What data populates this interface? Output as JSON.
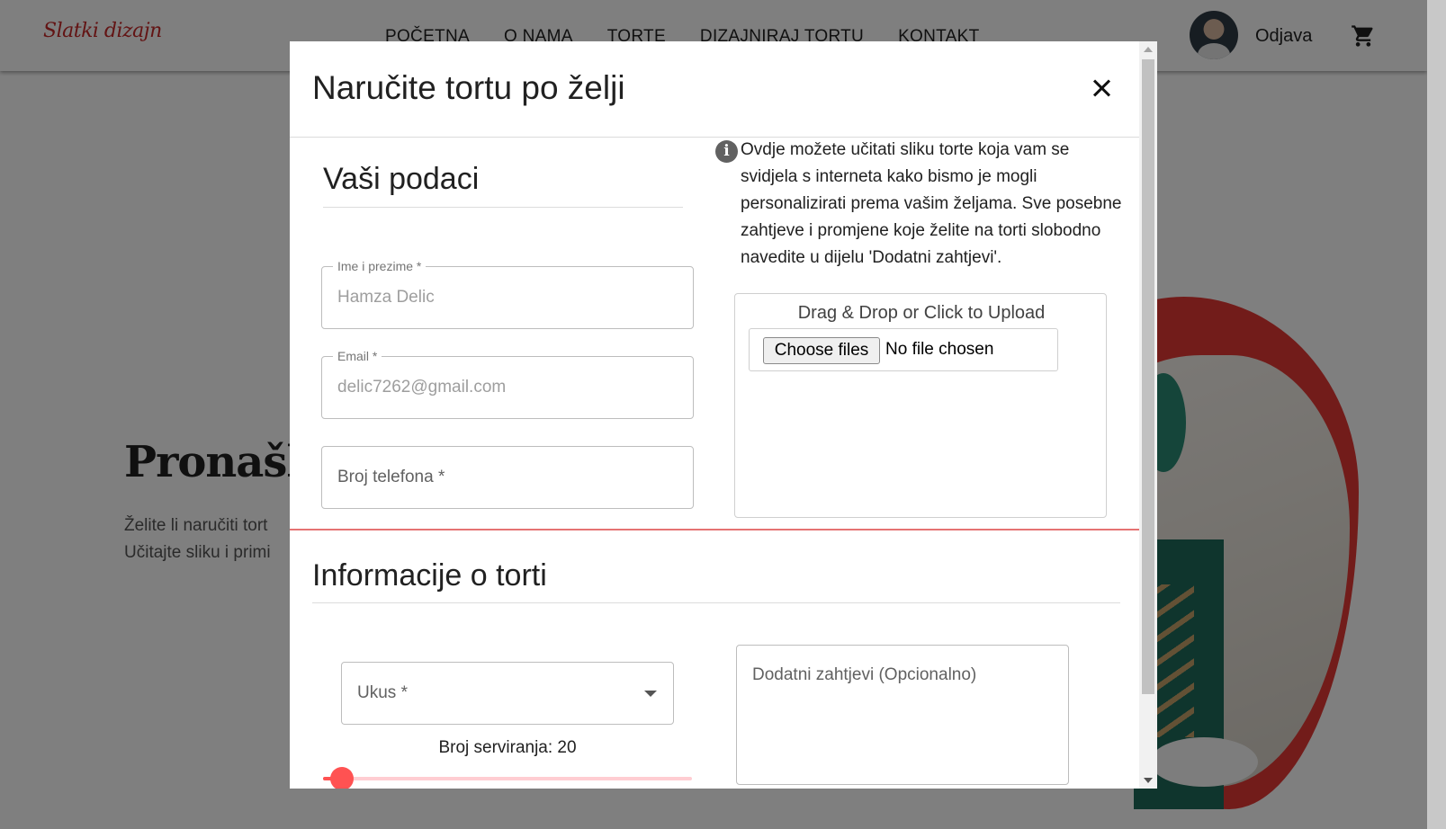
{
  "brand": {
    "logo": "Slatki dizajn",
    "accent_color": "#e53935"
  },
  "nav": {
    "links": [
      "POČETNA",
      "O NAMA",
      "TORTE",
      "DIZAJNIRAJ TORTU",
      "KONTAKT"
    ],
    "logout_label": "Odjava",
    "cart_icon": "shopping-cart-icon",
    "avatar_icon": "user-avatar"
  },
  "hero": {
    "title": "Pronašli",
    "text_line1": "Želite li naručiti tort",
    "text_line2": "Učitajte sliku i primi"
  },
  "modal": {
    "title": "Naručite tortu po želji",
    "close_icon": "close-icon",
    "personal_section": {
      "title": "Vaši podaci",
      "name_label": "Ime i prezime *",
      "name_value": "Hamza Delic",
      "email_label": "Email *",
      "email_value": "delic7262@gmail.com",
      "phone_placeholder": "Broj telefona *"
    },
    "upload": {
      "info_icon": "info-icon",
      "info_text": "Ovdje možete učitati sliku torte koja vam se svidjela s interneta kako bismo je mogli personalizirati prema vašim željama. Sve posebne zahtjeve i promjene koje želite na torti slobodno navedite u dijelu 'Dodatni zahtjevi'.",
      "dropzone_label": "Drag & Drop or Click to Upload",
      "choose_files_label": "Choose files",
      "no_file_text": "No file chosen"
    },
    "cake_section": {
      "title": "Informacije o torti",
      "flavor_label": "Ukus *",
      "servings_label": "Broj serviranja: 20",
      "servings_value": 20,
      "servings_slider_fraction": 0.05,
      "extra_requests_placeholder": "Dodatni zahtjevi (Opcionalno)"
    }
  }
}
